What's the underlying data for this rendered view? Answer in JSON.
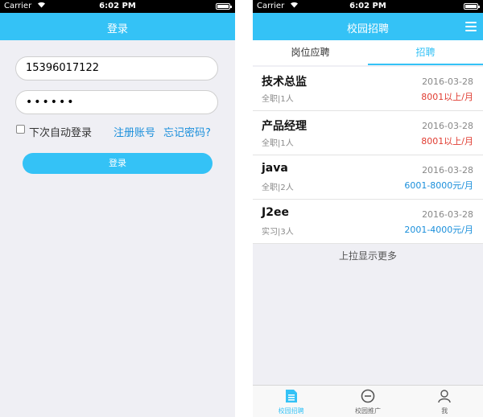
{
  "status": {
    "carrier": "Carrier",
    "time": "6:02 PM"
  },
  "login": {
    "title": "登录",
    "phone_value": "15396017122",
    "password_value": "••••••",
    "auto_login": "下次自动登录",
    "register": "注册账号",
    "forgot": "忘记密码?",
    "submit": "登录"
  },
  "recruit": {
    "title": "校园招聘",
    "tabs": [
      "岗位应聘",
      "招聘"
    ],
    "jobs": [
      {
        "title": "技术总监",
        "date": "2016-03-28",
        "meta": "全职|1人",
        "salary": "8001以上/月"
      },
      {
        "title": "产品经理",
        "date": "2016-03-28",
        "meta": "全职|1人",
        "salary": "8001以上/月"
      },
      {
        "title": "java",
        "date": "2016-03-28",
        "meta": "全职|2人",
        "salary": "6001-8000元/月"
      },
      {
        "title": "J2ee",
        "date": "2016-03-28",
        "meta": "实习|3人",
        "salary": "2001-4000元/月"
      }
    ],
    "more": "上拉显示更多",
    "tabbar": [
      "校园招聘",
      "校园推广",
      "我"
    ]
  },
  "colors": {
    "accent": "#34c2f6",
    "salary_high": "#e03c31",
    "salary_mid": "#1a8fdb"
  },
  "icons": [
    "wifi-icon",
    "battery-icon",
    "menu-icon",
    "document-icon",
    "clock-icon",
    "user-icon"
  ]
}
